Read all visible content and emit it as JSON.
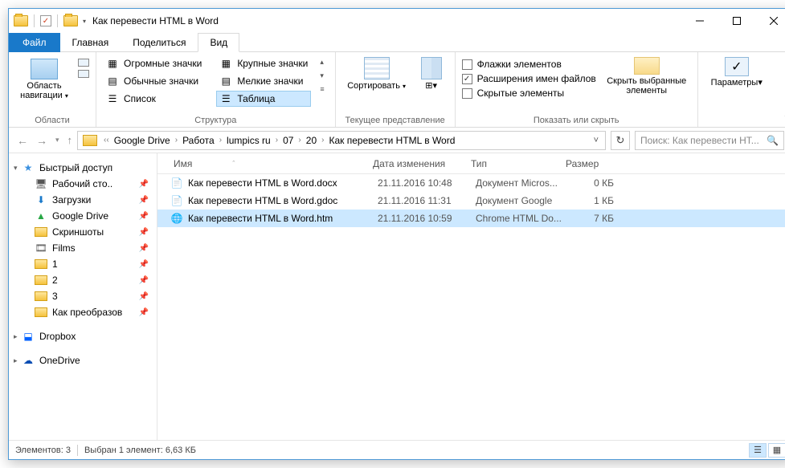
{
  "window": {
    "title": "Как перевести HTML в Word"
  },
  "tabs": {
    "file": "Файл",
    "home": "Главная",
    "share": "Поделиться",
    "view": "Вид"
  },
  "ribbon": {
    "nav_pane": "Область навигации",
    "group_panes": "Области",
    "layout": {
      "huge": "Огромные значки",
      "large": "Крупные значки",
      "normal": "Обычные значки",
      "small": "Мелкие значки",
      "list": "Список",
      "table": "Таблица"
    },
    "group_layout": "Структура",
    "sort": "Сортировать",
    "group_view": "Текущее представление",
    "checks": {
      "item_checkboxes": "Флажки элементов",
      "file_ext": "Расширения имен файлов",
      "hidden": "Скрытые элементы"
    },
    "hide_selected": "Скрыть выбранные элементы",
    "group_show": "Показать или скрыть",
    "options": "Параметры"
  },
  "breadcrumb": [
    "Google Drive",
    "Работа",
    "lumpics ru",
    "07",
    "20",
    "Как перевести HTML в Word"
  ],
  "search_placeholder": "Поиск: Как перевести HT...",
  "columns": {
    "name": "Имя",
    "date": "Дата изменения",
    "type": "Тип",
    "size": "Размер"
  },
  "files": [
    {
      "name": "Как перевести HTML в Word.docx",
      "date": "21.11.2016 10:48",
      "type": "Документ Micros...",
      "size": "0 КБ",
      "icon": "docx"
    },
    {
      "name": "Как перевести HTML в Word.gdoc",
      "date": "21.11.2016 11:31",
      "type": "Документ Google",
      "size": "1 КБ",
      "icon": "gdoc"
    },
    {
      "name": "Как перевести HTML в Word.htm",
      "date": "21.11.2016 10:59",
      "type": "Chrome HTML Do...",
      "size": "7 КБ",
      "icon": "htm",
      "selected": true
    }
  ],
  "sidebar": {
    "quick": "Быстрый доступ",
    "items": [
      {
        "label": "Рабочий сто..",
        "icon": "desktop"
      },
      {
        "label": "Загрузки",
        "icon": "downloads"
      },
      {
        "label": "Google Drive",
        "icon": "gdrive"
      },
      {
        "label": "Скриншоты",
        "icon": "folder"
      },
      {
        "label": "Films",
        "icon": "films"
      },
      {
        "label": "1",
        "icon": "folder"
      },
      {
        "label": "2",
        "icon": "folder"
      },
      {
        "label": "3",
        "icon": "folder"
      },
      {
        "label": "Как преобразов",
        "icon": "folder"
      }
    ],
    "dropbox": "Dropbox",
    "onedrive": "OneDrive"
  },
  "status": {
    "count": "Элементов: 3",
    "selection": "Выбран 1 элемент: 6,63 КБ"
  }
}
